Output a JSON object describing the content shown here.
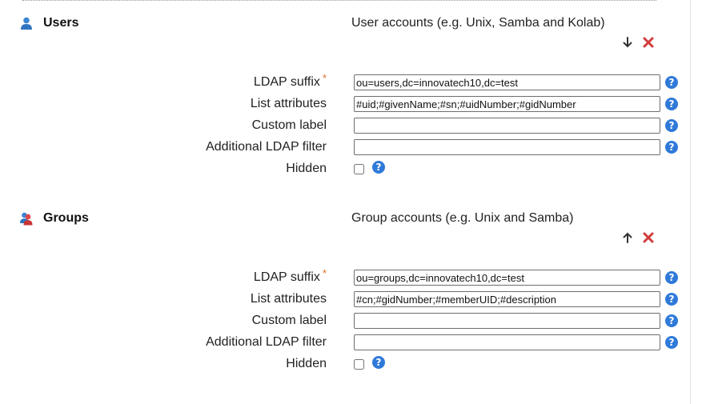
{
  "sections": [
    {
      "title": "Users",
      "icon": "user-icon",
      "description": "User accounts (e.g. Unix, Samba and Kolab)",
      "actions": [
        "move-down-icon",
        "delete-icon"
      ],
      "fields": {
        "ldap_suffix": {
          "label": "LDAP suffix",
          "required_mark": "*",
          "value": "ou=users,dc=innovatech10,dc=test"
        },
        "list_attributes": {
          "label": "List attributes",
          "value": "#uid;#givenName;#sn;#uidNumber;#gidNumber"
        },
        "custom_label": {
          "label": "Custom label",
          "value": ""
        },
        "additional_filter": {
          "label": "Additional LDAP filter",
          "value": ""
        },
        "hidden": {
          "label": "Hidden",
          "checked": false
        }
      }
    },
    {
      "title": "Groups",
      "icon": "group-icon",
      "description": "Group accounts (e.g. Unix and Samba)",
      "actions": [
        "move-up-icon",
        "delete-icon"
      ],
      "fields": {
        "ldap_suffix": {
          "label": "LDAP suffix",
          "required_mark": "*",
          "value": "ou=groups,dc=innovatech10,dc=test"
        },
        "list_attributes": {
          "label": "List attributes",
          "value": "#cn;#gidNumber;#memberUID;#description"
        },
        "custom_label": {
          "label": "Custom label",
          "value": ""
        },
        "additional_filter": {
          "label": "Additional LDAP filter",
          "value": ""
        },
        "hidden": {
          "label": "Hidden",
          "checked": false
        }
      }
    }
  ],
  "help_glyph": "?",
  "colors": {
    "help": "#2f7ad9",
    "delete": "#d23b3b",
    "required": "#e07020"
  }
}
